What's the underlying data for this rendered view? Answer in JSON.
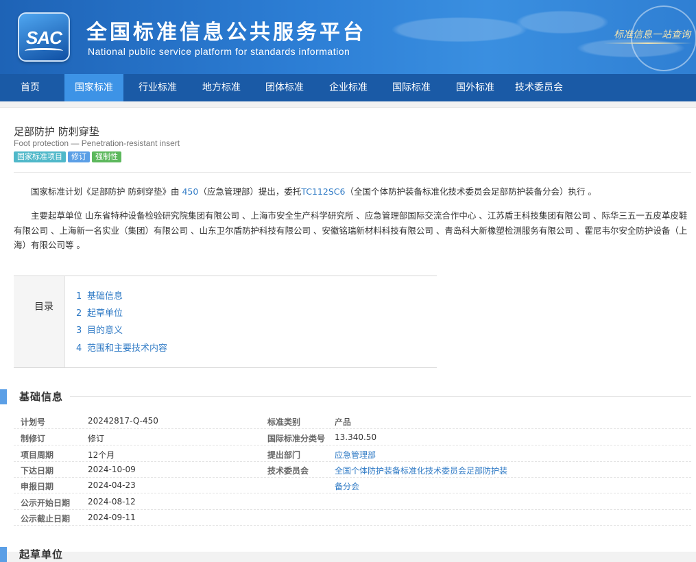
{
  "header": {
    "logo_text": "SAC",
    "title": "全国标准信息公共服务平台",
    "subtitle": "National public service platform  for standards information",
    "slogan": "标准信息一站查询"
  },
  "nav": [
    {
      "label": "首页"
    },
    {
      "label": "国家标准"
    },
    {
      "label": "行业标准"
    },
    {
      "label": "地方标准"
    },
    {
      "label": "团体标准"
    },
    {
      "label": "企业标准"
    },
    {
      "label": "国际标准"
    },
    {
      "label": "国外标准"
    },
    {
      "label": "技术委员会"
    }
  ],
  "standard": {
    "title_cn": "足部防护 防刺穿垫",
    "title_en": "Foot protection — Penetration-resistant insert",
    "badges": [
      {
        "label": "国家标准项目",
        "color": "#4fb8c9"
      },
      {
        "label": "修订",
        "color": "#5b9fe6"
      },
      {
        "label": "强制性",
        "color": "#5cb85c"
      }
    ],
    "plan_para": {
      "p1": "国家标准计划《足部防护 防刺穿垫》由 ",
      "plan_no": "450",
      "p2": "（应急管理部）提出，委托",
      "tc": "TC112SC6",
      "p3": "（全国个体防护装备标准化技术委员会足部防护装备分会）执行 。"
    },
    "drafters_para": "主要起草单位 山东省特种设备检验研究院集团有限公司 、上海市安全生产科学研究所 、应急管理部国际交流合作中心 、江苏盾王科技集团有限公司 、际华三五一五皮革皮鞋有限公司 、上海新一名实业（集团）有限公司 、山东卫尔盾防护科技有限公司 、安徽铭瑞新材料科技有限公司 、青岛科大新橡塑检测服务有限公司 、霍尼韦尔安全防护设备（上海）有限公司等 。"
  },
  "toc": {
    "label": "目录",
    "items": [
      {
        "num": "1",
        "label": "基础信息"
      },
      {
        "num": "2",
        "label": "起草单位"
      },
      {
        "num": "3",
        "label": "目的意义"
      },
      {
        "num": "4",
        "label": "范围和主要技术内容"
      }
    ]
  },
  "section_basic": {
    "title": "基础信息",
    "left": [
      {
        "label": "计划号",
        "value": "20242817-Q-450"
      },
      {
        "label": "制修订",
        "value": "修订"
      },
      {
        "label": "项目周期",
        "value": "12个月"
      },
      {
        "label": "下达日期",
        "value": "2024-10-09"
      },
      {
        "label": "申报日期",
        "value": "2024-04-23"
      },
      {
        "label": "公示开始日期",
        "value": "2024-08-12"
      },
      {
        "label": "公示截止日期",
        "value": "2024-09-11"
      }
    ],
    "right": [
      {
        "label": "标准类别",
        "value": "产品"
      },
      {
        "label": "国际标准分类号",
        "value": "13.340.50"
      },
      {
        "label": "提出部门",
        "value": "应急管理部"
      },
      {
        "label": "技术委员会",
        "value": "全国个体防护装备标准化技术委员会足部防护装"
      },
      {
        "label": "",
        "value": "备分会"
      }
    ]
  },
  "section_drafters": {
    "title": "起草单位"
  }
}
